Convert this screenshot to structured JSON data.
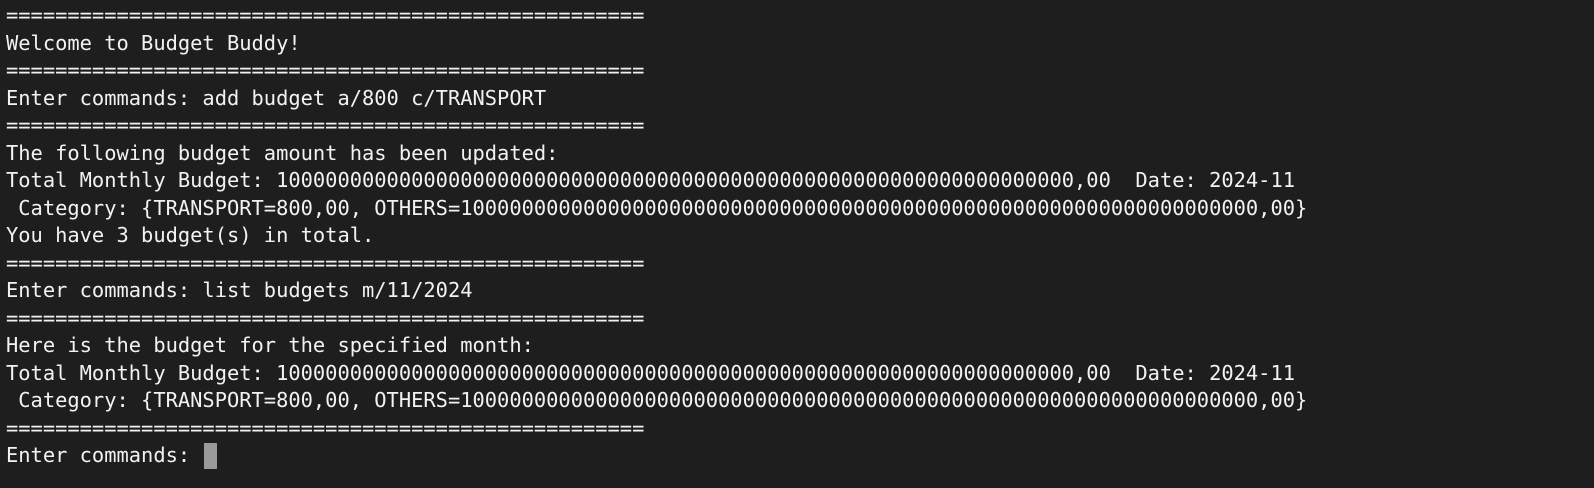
{
  "terminal": {
    "lines": [
      "====================================================",
      "Welcome to Budget Buddy!",
      "====================================================",
      "Enter commands: add budget a/800 c/TRANSPORT",
      "====================================================",
      "The following budget amount has been updated:",
      "Total Monthly Budget: 10000000000000000000000000000000000000000000000000000000000000000,00  Date: 2024-11",
      " Category: {TRANSPORT=800,00, OTHERS=10000000000000000000000000000000000000000000000000000000000000000,00}",
      "You have 3 budget(s) in total.",
      "====================================================",
      "Enter commands: list budgets m/11/2024",
      "====================================================",
      "Here is the budget for the specified month:",
      "Total Monthly Budget: 10000000000000000000000000000000000000000000000000000000000000000,00  Date: 2024-11",
      " Category: {TRANSPORT=800,00, OTHERS=10000000000000000000000000000000000000000000000000000000000000000,00}",
      "===================================================="
    ],
    "prompt": "Enter commands: ",
    "background_color": "#1e1e1e",
    "text_color": "#f2f2f2",
    "cursor_color": "#9a9a9a"
  }
}
